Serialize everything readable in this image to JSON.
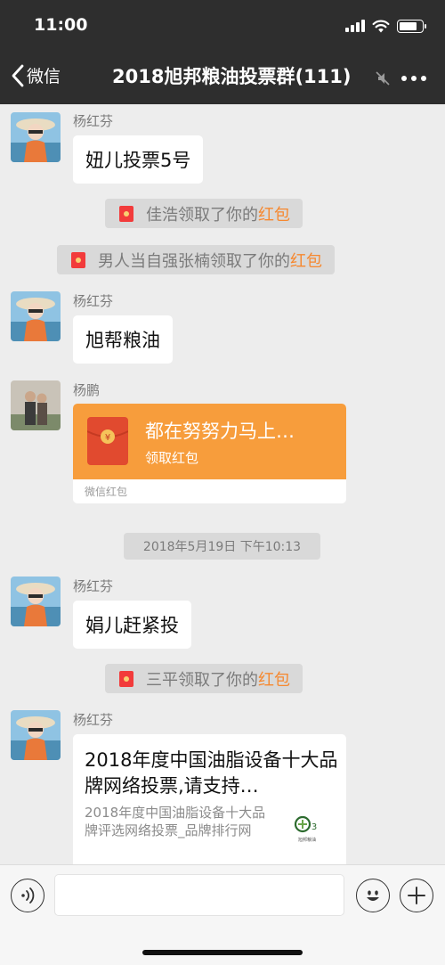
{
  "status_bar": {
    "time": "11:00"
  },
  "nav": {
    "back_label": "微信",
    "title": "2018旭邦粮油投票群(111)"
  },
  "messages": [
    {
      "sender": "杨红芬",
      "text": "妞儿投票5号"
    },
    {
      "sender": "杨红芬",
      "text": "旭帮粮油"
    },
    {
      "sender": "杨鹏"
    },
    {
      "sender": "杨红芬",
      "text": "娟儿赶紧投"
    },
    {
      "sender": "杨红芬"
    }
  ],
  "system_notices": [
    {
      "text": "佳浩领取了你的",
      "highlight": "红包"
    },
    {
      "text": "男人当自强张楠领取了你的",
      "highlight": "红包"
    },
    {
      "text": "三平领取了你的",
      "highlight": "红包"
    }
  ],
  "red_packet": {
    "title": "都在努努力马上…",
    "subtitle": "领取红包",
    "footer": "微信红包"
  },
  "timestamp": "2018年5月19日 下午10:13",
  "link_card": {
    "title": "2018年度中国油脂设备十大品牌网络投票,请支持…",
    "description": "2018年度中国油脂设备十大品牌评选网络投票_品牌排行网",
    "logo_text": "旭邦粮油"
  },
  "input": {
    "placeholder": ""
  },
  "colors": {
    "header_bg": "#2e2e2e",
    "chat_bg": "#ededed",
    "red_packet": "#f79d3c",
    "highlight": "#f6882f"
  }
}
